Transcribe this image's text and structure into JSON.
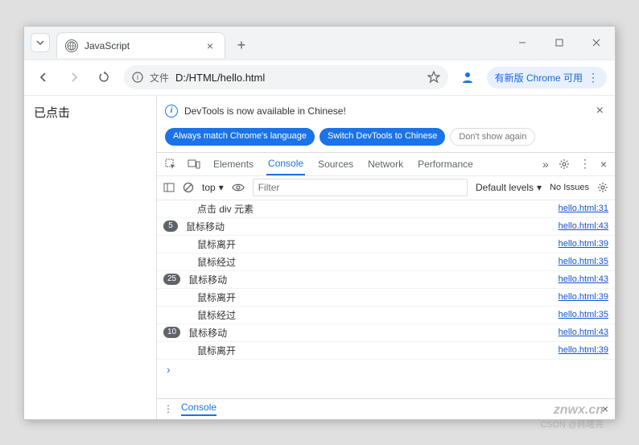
{
  "window": {
    "tab_title": "JavaScript",
    "controls": {
      "minimize": "–",
      "maximize": "□",
      "close": "×"
    }
  },
  "omnibox": {
    "protocol_label": "文件",
    "path": "D:/HTML/hello.html"
  },
  "update_msg": "有新版 Chrome 可用",
  "page": {
    "body_text": "已点击"
  },
  "devtools": {
    "notice": "DevTools is now available in Chinese!",
    "btn_match": "Always match Chrome's language",
    "btn_switch": "Switch DevTools to Chinese",
    "btn_dont": "Don't show again",
    "tabs": {
      "elements": "Elements",
      "console": "Console",
      "sources": "Sources",
      "network": "Network",
      "performance": "Performance"
    },
    "filterbar": {
      "context": "top",
      "filter_placeholder": "Filter",
      "levels": "Default levels",
      "issues": "No Issues"
    },
    "logs": [
      {
        "badge": "",
        "msg": "点击 div 元素",
        "src": "hello.html:31",
        "indent": true
      },
      {
        "badge": "5",
        "msg": "鼠标移动",
        "src": "hello.html:43"
      },
      {
        "badge": "",
        "msg": "鼠标离开",
        "src": "hello.html:39",
        "indent": true
      },
      {
        "badge": "",
        "msg": "鼠标经过",
        "src": "hello.html:35",
        "indent": true
      },
      {
        "badge": "25",
        "msg": "鼠标移动",
        "src": "hello.html:43"
      },
      {
        "badge": "",
        "msg": "鼠标离开",
        "src": "hello.html:39",
        "indent": true
      },
      {
        "badge": "",
        "msg": "鼠标经过",
        "src": "hello.html:35",
        "indent": true
      },
      {
        "badge": "10",
        "msg": "鼠标移动",
        "src": "hello.html:43"
      },
      {
        "badge": "",
        "msg": "鼠标离开",
        "src": "hello.html:39",
        "indent": true
      }
    ],
    "drawer_tab": "Console"
  },
  "watermark": "znwx.cn",
  "watermark_sub": "CSDN @韩曙亮"
}
